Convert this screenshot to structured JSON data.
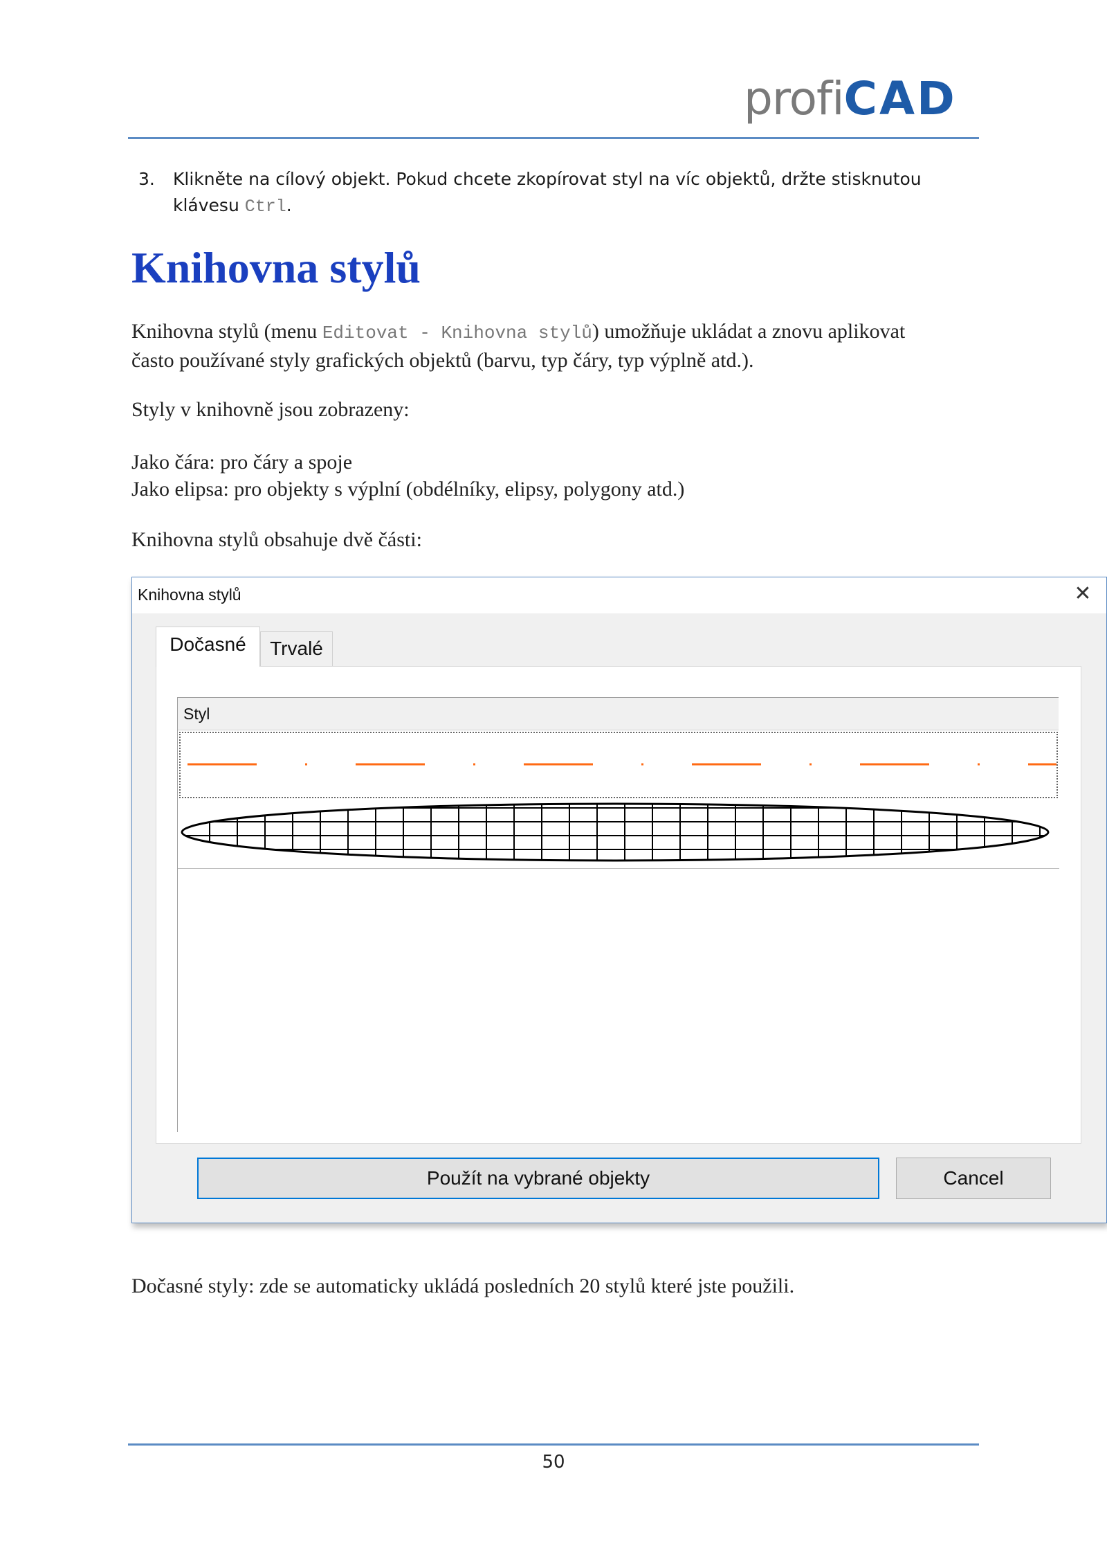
{
  "header": {
    "logo_profi": "profi",
    "logo_cad": "CAD",
    "accent_color": "#5b8bc4",
    "logo_gray": "#7a7a7a",
    "logo_blue": "#1e5ba8"
  },
  "step": {
    "number": "3.",
    "text_before": "Klikněte na cílový objekt. Pokud chcete zkopírovat styl na víc objektů, držte stisknutou klávesu ",
    "key": "Ctrl",
    "text_after": "."
  },
  "heading": {
    "title": "Knihovna stylů",
    "color": "#1a3fbf"
  },
  "intro": {
    "before": "Knihovna stylů (menu ",
    "menu_path": "Editovat - Knihovna stylů",
    "after_line1": ") umožňuje ukládat a znovu aplikovat",
    "line2": "často používané styly grafických objektů (barvu, typ čáry, typ výplně atd.)."
  },
  "display": {
    "label": "Styly v knihovně jsou zobrazeny:",
    "item_line": "Jako čára: pro čáry a spoje",
    "item_ellipse": "Jako elipsa: pro objekty s výplní (obdélníky, elipsy, polygony atd.)"
  },
  "parts_label": "Knihovna stylů obsahuje dvě části:",
  "dialog": {
    "title": "Knihovna stylů",
    "close_glyph": "✕",
    "tabs": [
      {
        "label": "Dočasné",
        "active": true
      },
      {
        "label": "Trvalé",
        "active": false
      }
    ],
    "list_header": "Styl",
    "line_style_color": "#ff6a13",
    "apply_button": "Použít na vybrané objekty",
    "cancel_button": "Cancel"
  },
  "footer_text": "Dočasné styly: zde se automaticky ukládá posledních 20 stylů které jste použili.",
  "page_number": "50"
}
